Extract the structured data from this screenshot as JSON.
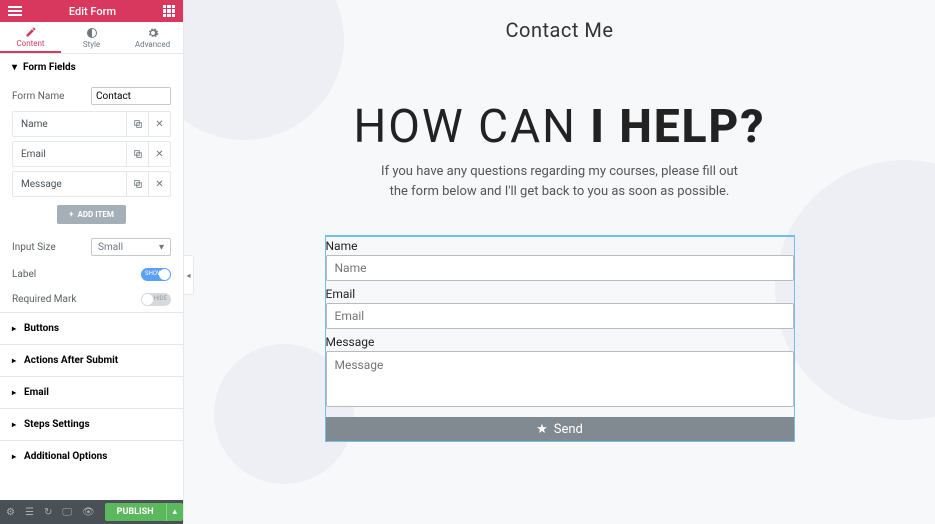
{
  "header": {
    "title": "Edit Form"
  },
  "tabs": {
    "content": "Content",
    "style": "Style",
    "advanced": "Advanced"
  },
  "sections": {
    "form_fields": "Form Fields",
    "buttons": "Buttons",
    "actions_after_submit": "Actions After Submit",
    "email": "Email",
    "steps_settings": "Steps Settings",
    "additional_options": "Additional Options"
  },
  "labels": {
    "form_name": "Form Name",
    "input_size": "Input Size",
    "label": "Label",
    "required_mark": "Required Mark",
    "add_item": "ADD ITEM",
    "toggle_show": "SHOW",
    "toggle_hide": "HIDE"
  },
  "values": {
    "form_name": "Contact",
    "input_size": "Small"
  },
  "fields": [
    {
      "label": "Name"
    },
    {
      "label": "Email"
    },
    {
      "label": "Message"
    }
  ],
  "footer": {
    "publish": "PUBLISH"
  },
  "preview": {
    "section_label": "Contact Me",
    "hero_light": "HOW CAN ",
    "hero_bold": "I HELP?",
    "hero_sub1": "If you have any questions regarding my courses, please fill out",
    "hero_sub2": "the form below and I'll get back to you as soon as possible.",
    "name_label": "Name",
    "name_ph": "Name",
    "email_label": "Email",
    "email_ph": "Email",
    "message_label": "Message",
    "message_ph": "Message",
    "send": "Send"
  }
}
